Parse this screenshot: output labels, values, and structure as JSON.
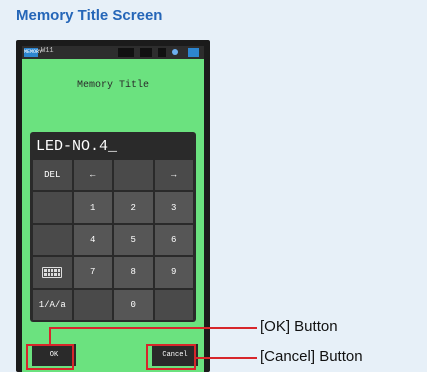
{
  "page_title": "Memory Title Screen",
  "device": {
    "status_bar": {
      "mem_label": "MEMORY",
      "text": "W11"
    },
    "screen_title": "Memory Title",
    "entry_value": "LED-NO.4_",
    "keys": {
      "del": "DEL",
      "left": "←",
      "right": "→",
      "n1": "1",
      "n2": "2",
      "n3": "3",
      "n4": "4",
      "n5": "5",
      "n6": "6",
      "n7": "7",
      "n8": "8",
      "n9": "9",
      "n0": "0",
      "mode": "1/A/a"
    },
    "ok_label": "OK",
    "cancel_label": "Cancel"
  },
  "callouts": {
    "ok": "[OK] Button",
    "cancel": "[Cancel] Button"
  },
  "colors": {
    "title_blue": "#2566b8",
    "screen_green": "#6be27f",
    "highlight_red": "#d7262b"
  }
}
